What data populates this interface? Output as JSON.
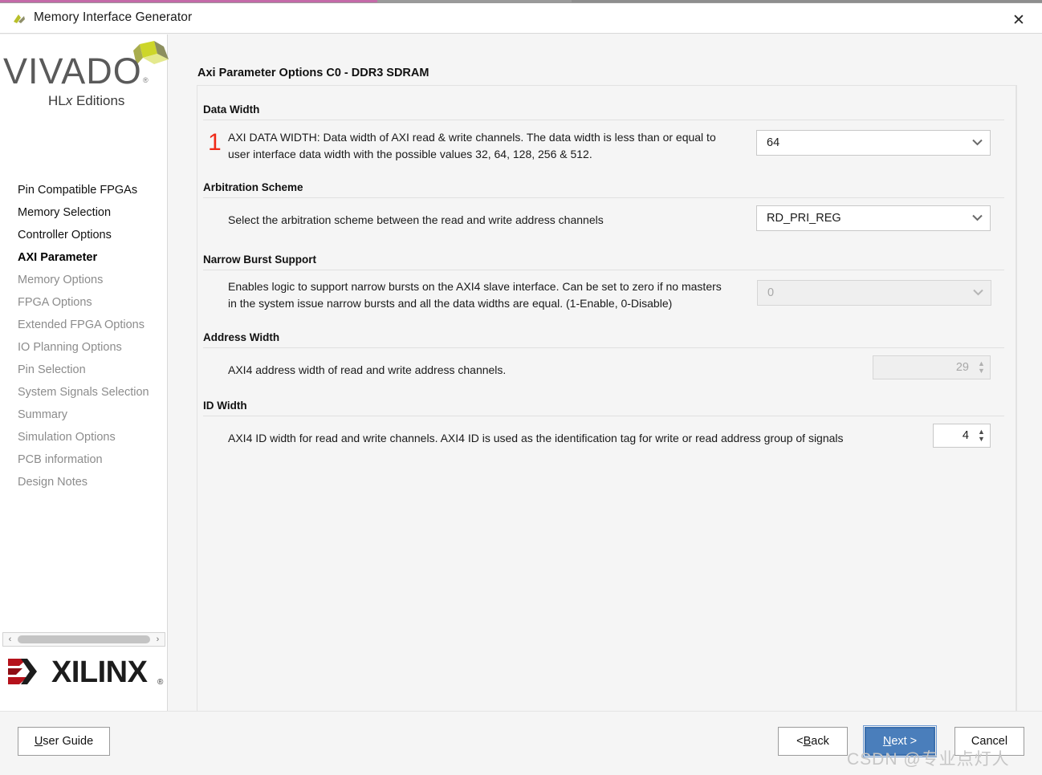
{
  "window": {
    "title": "Memory Interface Generator",
    "app_icon": "vivado-leaf-icon",
    "close_label": "✕"
  },
  "sidebar": {
    "logo": {
      "wordmark": "VIVADO",
      "registered": "®",
      "subtitle_pre": "HL",
      "subtitle_italic": "x",
      "subtitle_post": " Editions"
    },
    "items": [
      {
        "label": "Pin Compatible FPGAs",
        "state": "done"
      },
      {
        "label": "Memory Selection",
        "state": "done"
      },
      {
        "label": "Controller Options",
        "state": "done"
      },
      {
        "label": "AXI Parameter",
        "state": "current"
      },
      {
        "label": "Memory Options",
        "state": "pending"
      },
      {
        "label": "FPGA Options",
        "state": "pending"
      },
      {
        "label": "Extended FPGA Options",
        "state": "pending"
      },
      {
        "label": "IO Planning Options",
        "state": "pending"
      },
      {
        "label": "Pin Selection",
        "state": "pending"
      },
      {
        "label": "System Signals Selection",
        "state": "pending"
      },
      {
        "label": "Summary",
        "state": "pending"
      },
      {
        "label": "Simulation Options",
        "state": "pending"
      },
      {
        "label": "PCB information",
        "state": "pending"
      },
      {
        "label": "Design Notes",
        "state": "pending"
      }
    ],
    "scrollbar": {
      "left_arrow": "‹",
      "right_arrow": "›"
    },
    "vendor_logo": {
      "wordmark": "XILINX",
      "registered": "®"
    }
  },
  "main": {
    "page_title": "Axi Parameter Options C0 - DDR3 SDRAM",
    "groups": [
      {
        "header": "Data Width",
        "marker": "1",
        "description_line1": "AXI DATA WIDTH: Data width of AXI read & write channels. The data width is less than or equal to",
        "description_line2": "user interface data width with the possible values 32, 64, 128, 256 & 512.",
        "control": {
          "type": "combo",
          "value": "64",
          "enabled": true,
          "arrow": "⌄"
        }
      },
      {
        "header": "Arbitration Scheme",
        "description_line1": "Select the arbitration scheme between the read and write address channels",
        "control": {
          "type": "combo",
          "value": "RD_PRI_REG",
          "enabled": true,
          "arrow": "⌄"
        }
      },
      {
        "header": "Narrow Burst Support",
        "description_line1": "Enables logic to support narrow bursts on the AXI4 slave interface. Can be set to zero if no masters",
        "description_line2": "in the system issue narrow bursts and all the data widths are equal. (1-Enable, 0-Disable)",
        "control": {
          "type": "combo",
          "value": "0",
          "enabled": false,
          "arrow": "⌄"
        }
      },
      {
        "header": "Address Width",
        "description_line1": "AXI4 address width of read and write address channels.",
        "control": {
          "type": "spinner",
          "value": "29",
          "enabled": false,
          "up": "▲",
          "down": "▼"
        }
      },
      {
        "header": "ID Width",
        "description_line1": "AXI4 ID width for read and write channels. AXI4 ID is used as the identification tag for write or read address group of signals",
        "control": {
          "type": "spinner",
          "value": "4",
          "enabled": true,
          "up": "▲",
          "down": "▼"
        }
      }
    ]
  },
  "footer": {
    "user_guide": {
      "accel": "U",
      "rest": "ser Guide"
    },
    "back": {
      "pre": "< ",
      "accel": "B",
      "rest": "ack"
    },
    "next": {
      "accel": "N",
      "rest": "ext >"
    },
    "cancel": {
      "label": "Cancel"
    }
  },
  "watermark": "CSDN @专业点灯人",
  "colors": {
    "marker_red": "#ef2a18",
    "primary_button": "#4a7ebb",
    "content_bg": "#f5f5f5",
    "vivado_gray": "#5a5a5a",
    "vivado_green": "#cdd62a",
    "xilinx_red": "#b5121b"
  }
}
